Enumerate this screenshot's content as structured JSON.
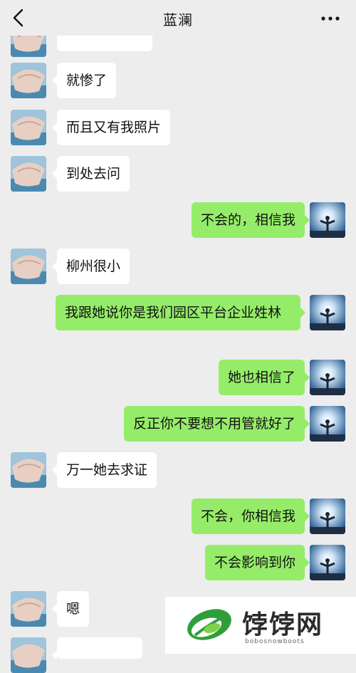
{
  "header": {
    "title": "蓝澜",
    "back_icon": "chevron-left-icon",
    "more_icon": "more-dots-icon"
  },
  "messages": [
    {
      "side": "left",
      "text": "就惨了"
    },
    {
      "side": "left",
      "text": "而且又有我照片"
    },
    {
      "side": "left",
      "text": "到处去问"
    },
    {
      "side": "right",
      "text": "不会的，相信我"
    },
    {
      "side": "left",
      "text": "柳州很小"
    },
    {
      "side": "right",
      "text": "我跟她说你是我们园区平台企业姓林"
    },
    {
      "side": "right",
      "text": "她也相信了"
    },
    {
      "side": "right",
      "text": "反正你不要想不用管就好了"
    },
    {
      "side": "left",
      "text": "万一她去求证"
    },
    {
      "side": "right",
      "text": "不会，你相信我"
    },
    {
      "side": "right",
      "text": "不会影响到你"
    },
    {
      "side": "left",
      "text": "嗯"
    }
  ],
  "watermark": {
    "brand": "饽饽网",
    "url": "bobosnowboots"
  },
  "colors": {
    "background": "#ededed",
    "left_bubble": "#ffffff",
    "right_bubble": "#95ec69",
    "logo_green": "#3fae3a"
  }
}
